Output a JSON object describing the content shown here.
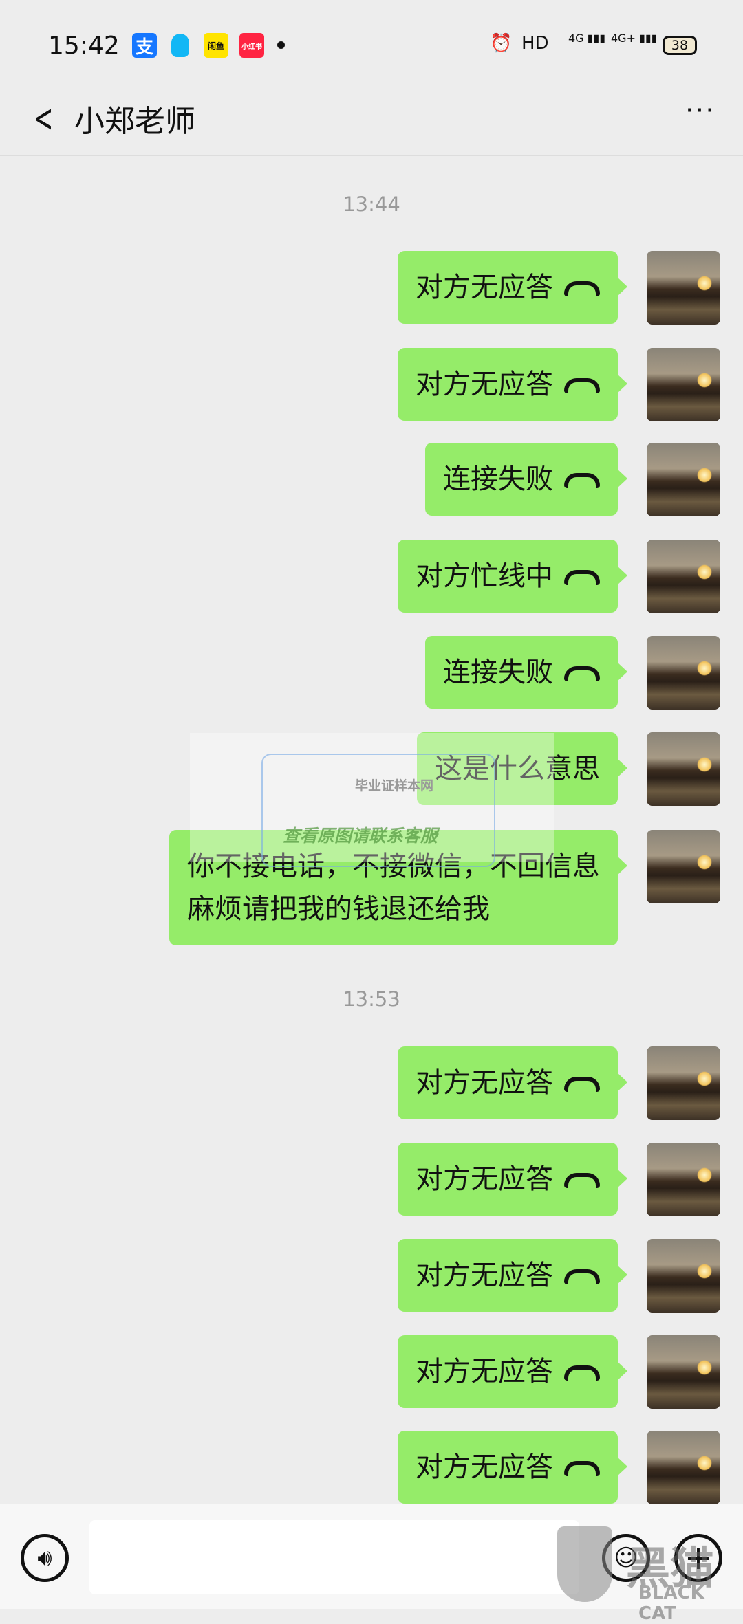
{
  "status_bar": {
    "time": "15:42",
    "apps": [
      {
        "name": "alipay",
        "label": "支",
        "color": "#1677ff"
      },
      {
        "name": "qq",
        "label": "",
        "color": "#12b7f5"
      },
      {
        "name": "xianyu",
        "label": "闲鱼",
        "color": "#ffe400"
      },
      {
        "name": "xiaohongshu",
        "label": "小红书",
        "color": "#ff2442"
      }
    ],
    "hd": "HD",
    "net1": "4G",
    "net2": "4G+",
    "battery": "38"
  },
  "header": {
    "title": "小郑老师",
    "more": "···",
    "back": "<"
  },
  "chat": {
    "groups": [
      {
        "timestamp": "13:44",
        "messages": [
          {
            "text": "对方无应答",
            "call": true
          },
          {
            "text": "对方无应答",
            "call": true
          },
          {
            "text": "连接失败",
            "call": true
          },
          {
            "text": "对方忙线中",
            "call": true
          },
          {
            "text": "连接失败",
            "call": true
          },
          {
            "text": "这是什么意思",
            "call": false
          },
          {
            "text": "你不接电话，不接微信，不回信息\n麻烦请把我的钱退还给我",
            "call": false
          }
        ]
      },
      {
        "timestamp": "13:53",
        "messages": [
          {
            "text": "对方无应答",
            "call": true
          },
          {
            "text": "对方无应答",
            "call": true
          },
          {
            "text": "对方无应答",
            "call": true
          },
          {
            "text": "对方无应答",
            "call": true
          },
          {
            "text": "对方无应答",
            "call": true
          }
        ]
      }
    ]
  },
  "watermark": {
    "site": "毕业证样本网",
    "notice": "查看原图请联系客服"
  },
  "logo": {
    "cn": "黑猫",
    "en": "BLACK CAT"
  },
  "input": {
    "placeholder": ""
  },
  "colors": {
    "bubble": "#95ec69",
    "background": "#ededed"
  }
}
